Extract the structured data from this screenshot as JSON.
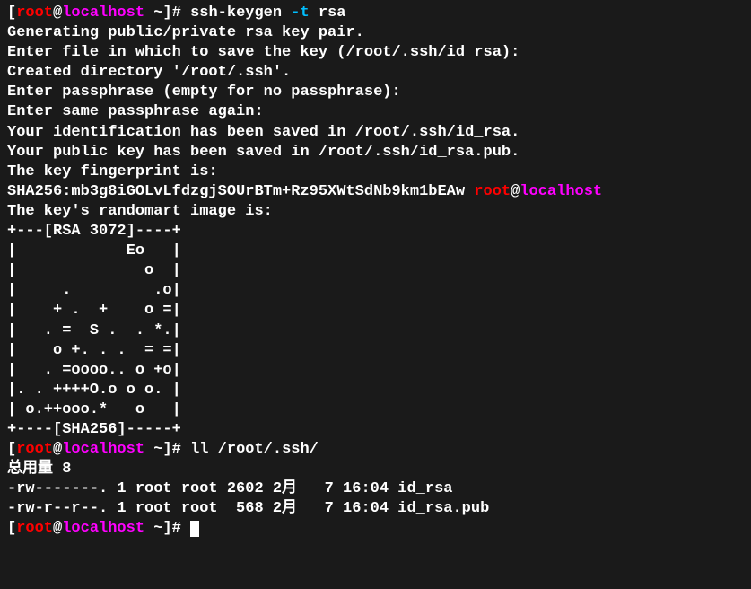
{
  "prompt1": {
    "open": "[",
    "user": "root",
    "at": "@",
    "host": "localhost",
    "path": " ~",
    "close": "]# ",
    "cmd": "ssh-keygen ",
    "flag": "-t",
    "arg": " rsa"
  },
  "output": {
    "l1": "Generating public/private rsa key pair.",
    "l2": "Enter file in which to save the key (/root/.ssh/id_rsa):",
    "l3": "Created directory '/root/.ssh'.",
    "l4": "Enter passphrase (empty for no passphrase):",
    "l5": "Enter same passphrase again:",
    "l6": "Your identification has been saved in /root/.ssh/id_rsa.",
    "l7": "Your public key has been saved in /root/.ssh/id_rsa.pub.",
    "l8": "The key fingerprint is:",
    "sha_prefix": "SHA256:mb3g8iGOLvLfdzgjSOUrBTm+Rz95XWtSdNb9km1bEAw ",
    "sha_user": "root",
    "sha_at": "@",
    "sha_host": "localhost",
    "l10": "The key's randomart image is:",
    "art1": "+---[RSA 3072]----+",
    "art2": "|            Eo   |",
    "art3": "|              o  |",
    "art4": "|     .         .o|",
    "art5": "|    + .  +    o =|",
    "art6": "|   . =  S .  . *.|",
    "art7": "|    o +. . .  = =|",
    "art8": "|   . =oooo.. o +o|",
    "art9": "|. . ++++O.o o o. |",
    "art10": "| o.++ooo.*   o   |",
    "art11": "+----[SHA256]-----+"
  },
  "prompt2": {
    "open": "[",
    "user": "root",
    "at": "@",
    "host": "localhost",
    "path": " ~",
    "close": "]# ",
    "cmd": "ll /root/.ssh/"
  },
  "listing": {
    "total": "总用量 8",
    "row1": "-rw-------. 1 root root 2602 2月   7 16:04 id_rsa",
    "row2": "-rw-r--r--. 1 root root  568 2月   7 16:04 id_rsa.pub"
  },
  "prompt3": {
    "open": "[",
    "user": "root",
    "at": "@",
    "host": "localhost",
    "path": " ~",
    "close": "]# "
  }
}
